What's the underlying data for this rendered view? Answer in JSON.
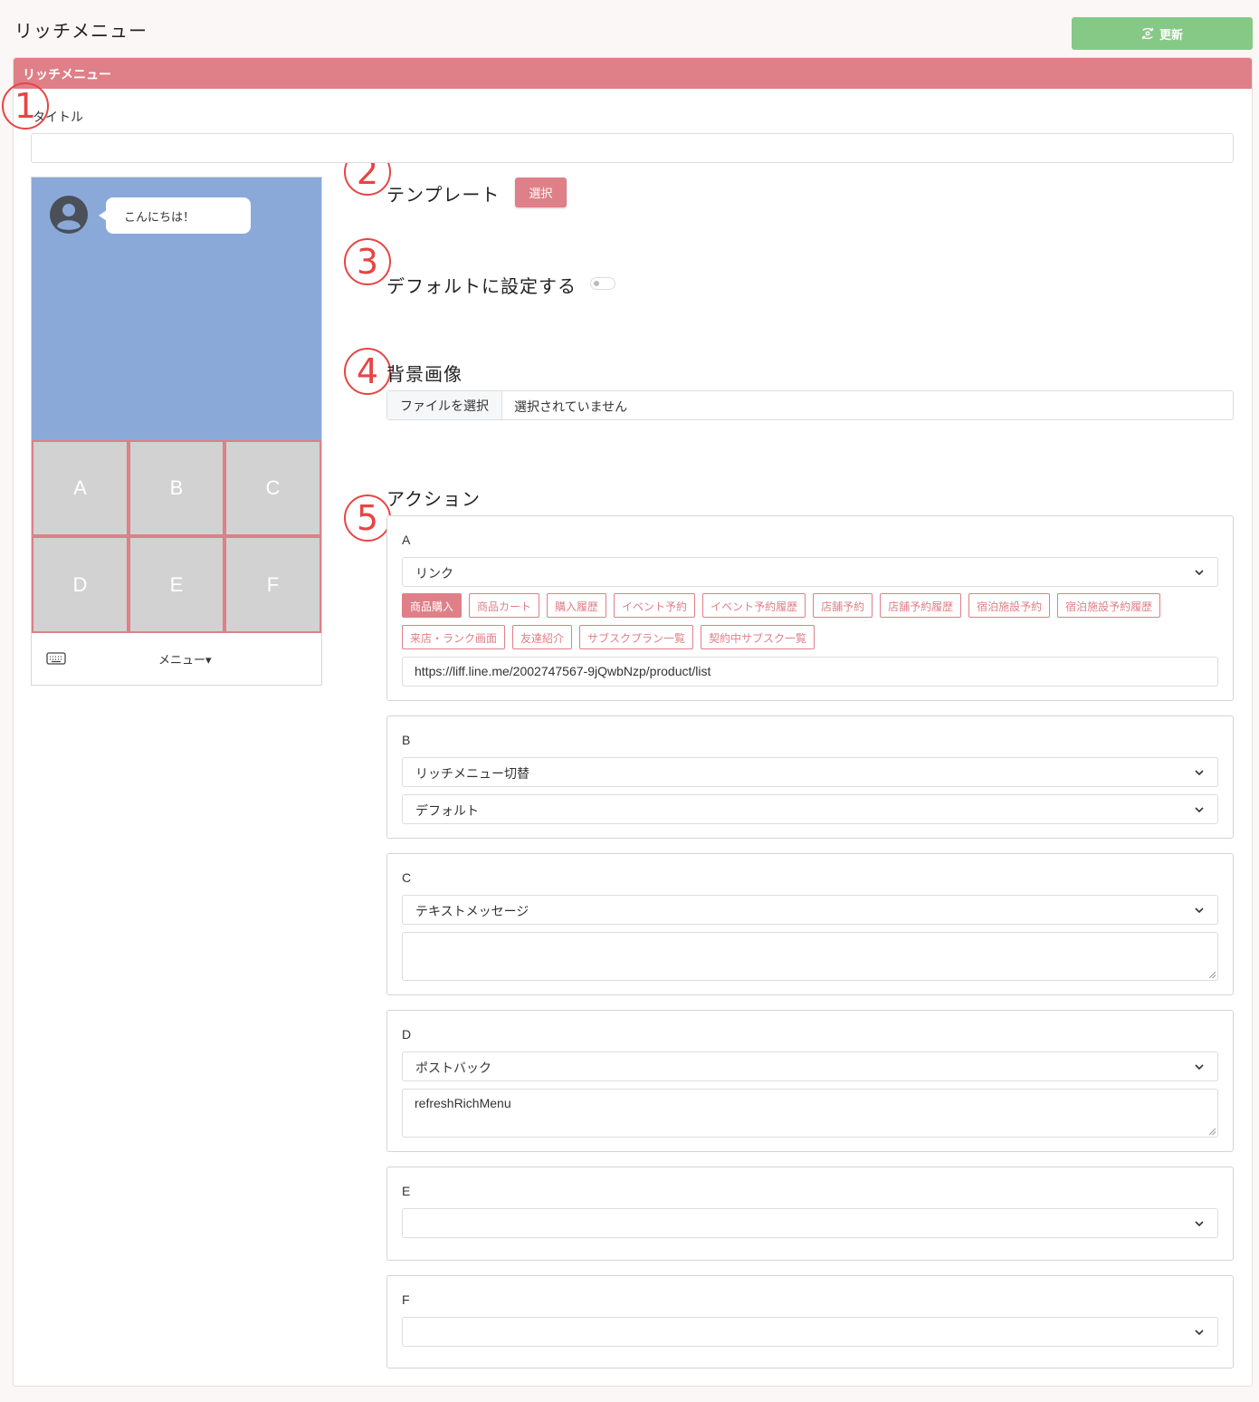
{
  "page": {
    "title": "リッチメニュー",
    "update_label": "更新"
  },
  "card": {
    "header": "リッチメニュー"
  },
  "markers": [
    "1",
    "2",
    "3",
    "4",
    "5"
  ],
  "fields": {
    "title_label": "タイトル",
    "template_label": "テンプレート",
    "template_button": "選択",
    "default_label": "デフォルトに設定する",
    "default_on": false,
    "bg_label": "背景画像",
    "file_button": "ファイルを選択",
    "file_status": "選択されていません",
    "action_label": "アクション"
  },
  "preview": {
    "bubble": "こんにちは！",
    "cells": [
      "A",
      "B",
      "C",
      "D",
      "E",
      "F"
    ],
    "menu_label": "メニュー▾",
    "icons": [
      "user-icon",
      "keyboard-icon"
    ]
  },
  "actions": {
    "A": {
      "label": "A",
      "type": "リンク",
      "tags": [
        "商品購入",
        "商品カート",
        "購入履歴",
        "イベント予約",
        "イベント予約履歴",
        "店舗予約",
        "店舗予約履歴",
        "宿泊施設予約",
        "宿泊施設予約履歴"
      ],
      "tags2": [
        "来店・ランク画面",
        "友達紹介",
        "サブスクプラン一覧",
        "契約中サブスク一覧"
      ],
      "active_tag": "商品購入",
      "url": "https://liff.line.me/2002747567-9jQwbNzp/product/list"
    },
    "B": {
      "label": "B",
      "type": "リッチメニュー切替",
      "target": "デフォルト"
    },
    "C": {
      "label": "C",
      "type": "テキストメッセージ",
      "text": ""
    },
    "D": {
      "label": "D",
      "type": "ポストバック",
      "data": "refreshRichMenu"
    },
    "E": {
      "label": "E",
      "type": ""
    },
    "F": {
      "label": "F",
      "type": ""
    }
  },
  "colors": {
    "accent": "#df7f87",
    "success": "#86c987",
    "preview_bg": "#8aa9d8",
    "marker": "#e84444"
  }
}
